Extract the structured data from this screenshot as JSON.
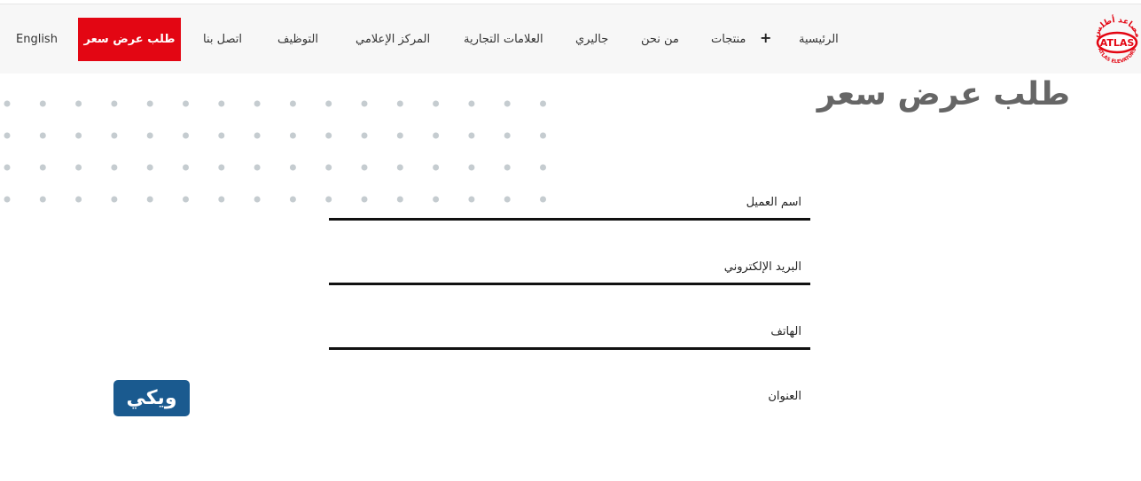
{
  "nav": {
    "english": "English",
    "cta": "طلب عرض سعر",
    "contact": "اتصل بنا",
    "careers": "التوظيف",
    "media": "المركز الإعلامي",
    "brands": "العلامات التجارية",
    "gallery": "جاليري",
    "about": "من نحن",
    "products": "منتجات",
    "products_expand": "+",
    "home": "الرئيسية"
  },
  "logo": {
    "text": "ATLAS",
    "arabic": "مصاعد أطلس",
    "english": "ATLAS ELEVATORS",
    "color": "#e30613"
  },
  "page": {
    "title": "طلب عرض سعر"
  },
  "form": {
    "name_label": "اسم العميل",
    "email_label": "البريد الإلكتروني",
    "phone_label": "الهاتف",
    "address_label": "العنوان"
  },
  "badge": {
    "text": "ويكي",
    "color": "#1a5a8f"
  },
  "colors": {
    "accent": "#e30613",
    "dots": "#c5ccd0",
    "title": "#666666"
  }
}
